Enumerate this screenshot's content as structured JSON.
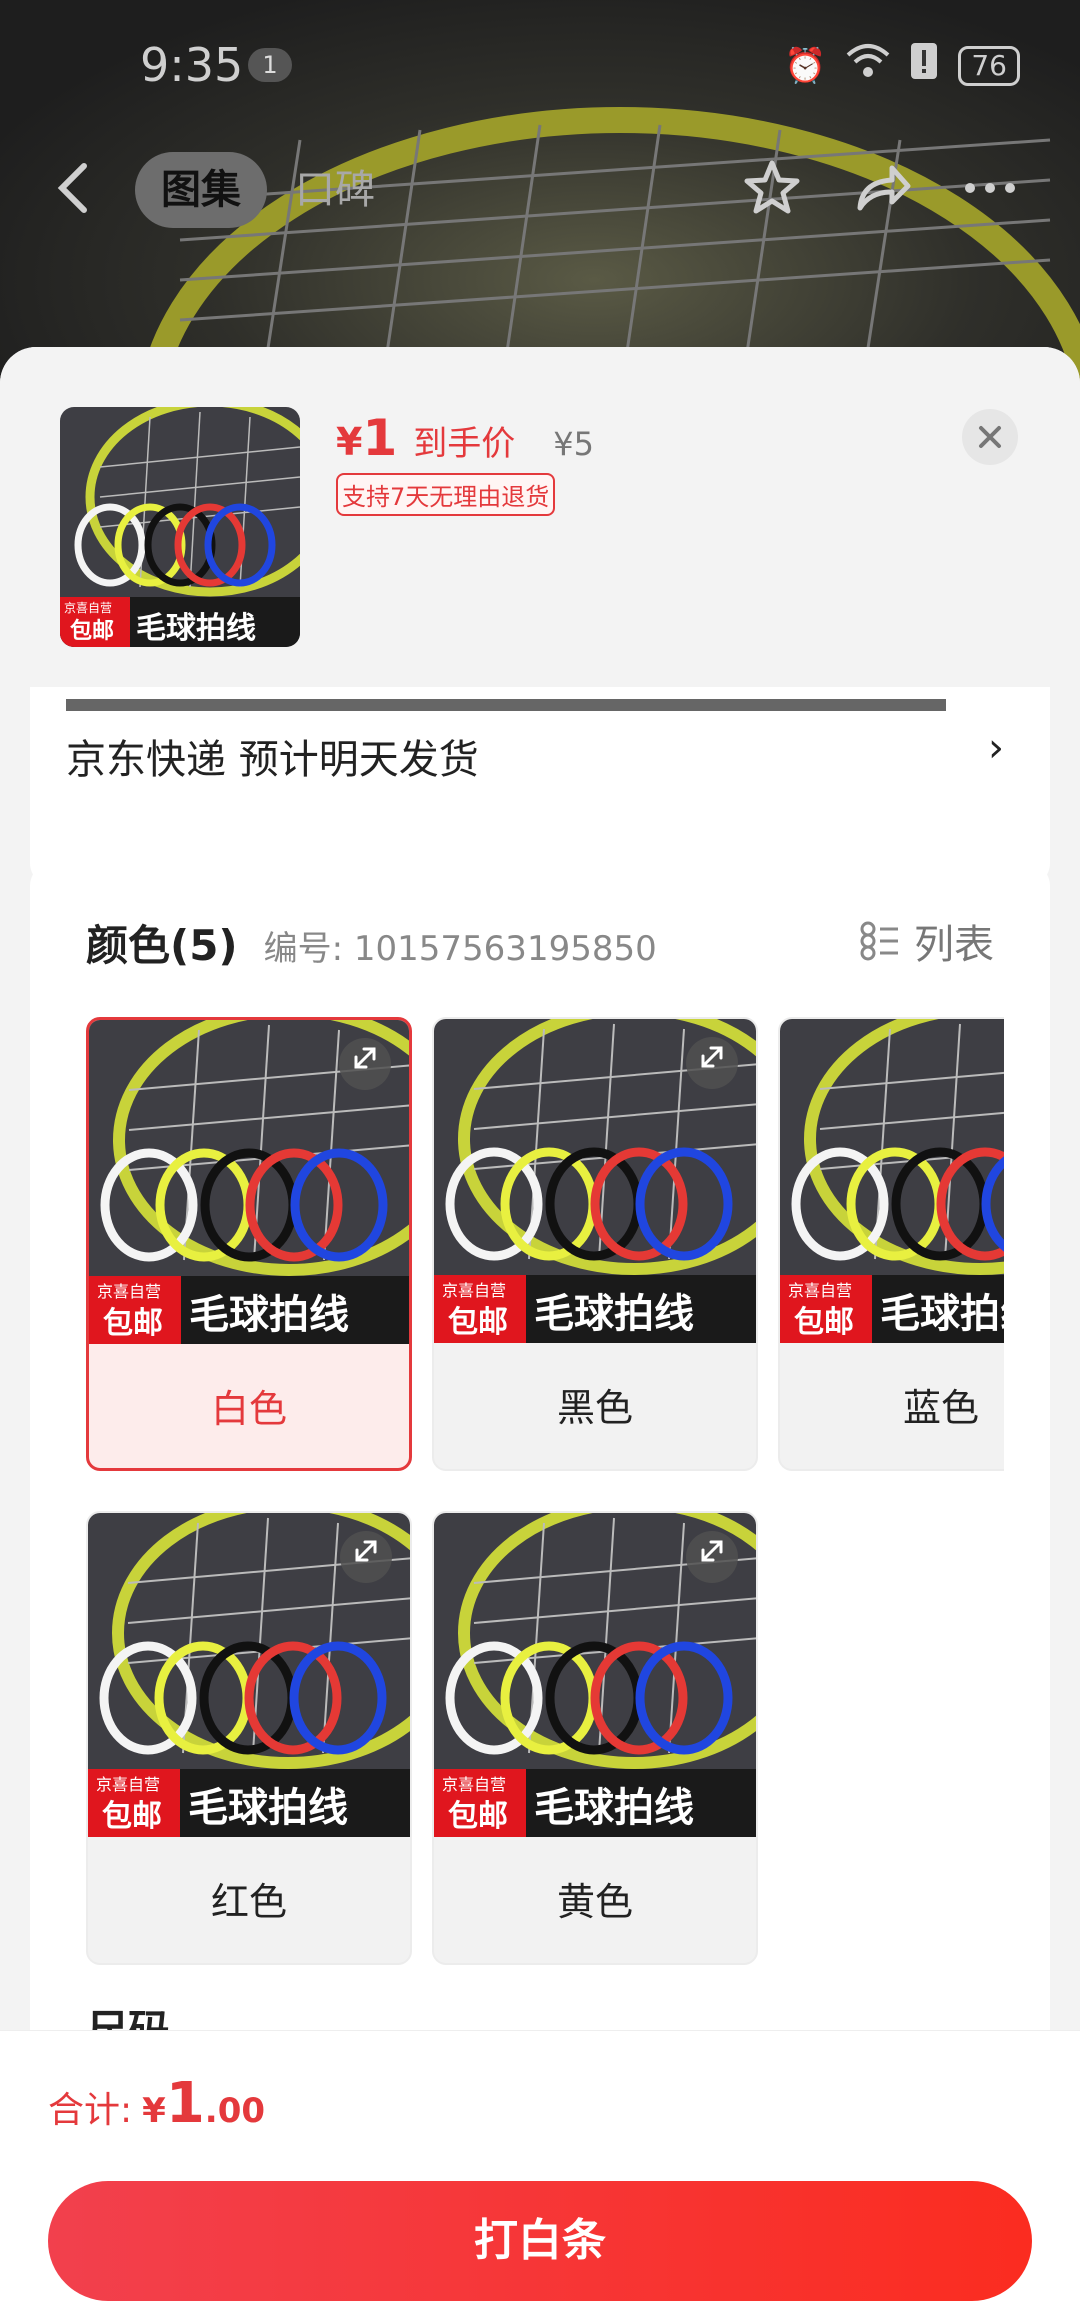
{
  "status_bar": {
    "time": "9:35",
    "notif_count": "1",
    "battery": "76"
  },
  "nav": {
    "tabs": [
      {
        "label": "图集",
        "active": true
      },
      {
        "label": "口碑",
        "active": false
      }
    ],
    "icons": [
      "back-icon",
      "star-icon",
      "share-icon",
      "more-icon"
    ]
  },
  "product": {
    "price_symbol": "¥",
    "price": "1",
    "price_label": "到手价",
    "original_price": "¥5",
    "promise_tag": "支持7天无理由退货",
    "thumb_caption": "毛球拍线",
    "thumb_badge_small": "京喜自营",
    "thumb_badge_big": "包邮"
  },
  "delivery": {
    "text": "京东快递 预计明天发货",
    "arrow": "›"
  },
  "color_section": {
    "title": "颜色(5)",
    "code": "编号: 10157563195850",
    "list_label": "列表",
    "options": [
      {
        "label": "白色",
        "selected": true
      },
      {
        "label": "黑色",
        "selected": false
      },
      {
        "label": "蓝色",
        "selected": false
      },
      {
        "label": "红色",
        "selected": false
      },
      {
        "label": "黄色",
        "selected": false
      }
    ]
  },
  "next_section_title": "尺码",
  "footer": {
    "total_label": "合计:",
    "total_symbol": "¥",
    "total_int": "1",
    "total_dec": ".00",
    "pay_button": "打白条"
  },
  "colors": {
    "accent": "#e4393c",
    "button_start": "#f2404d",
    "button_end": "#fb2c20"
  }
}
